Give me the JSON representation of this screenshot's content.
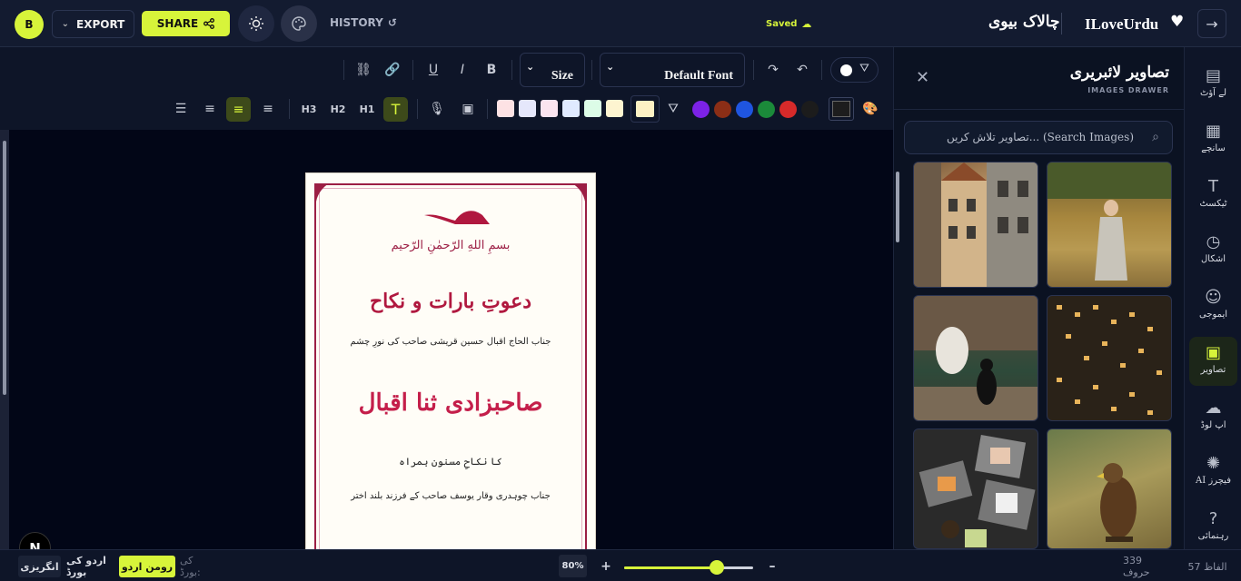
{
  "header": {
    "avatar_initial": "B",
    "export_label": "EXPORT",
    "share_label": "SHARE",
    "history_label": "HISTORY",
    "saved_label": "Saved",
    "brand_urdu": "چالاک بیوی",
    "brand": "ILoveUrdu"
  },
  "toolbar": {
    "size_label": "Size",
    "font_label": "Default Font",
    "headings": [
      "H3",
      "H2",
      "H1"
    ],
    "swatches": [
      "#fde2e4",
      "#e5e7fb",
      "#fbe4f0",
      "#e0eaff",
      "#dcfce7",
      "#fdf4d0"
    ],
    "selected_swatch": "#fdf1c4",
    "dots": [
      "#7c22e6",
      "#8b2e16",
      "#1f55e0",
      "#1b8a3a",
      "#d62a2a",
      "#1c1c1c"
    ]
  },
  "page": {
    "bismillah": "بسمِ اللهِ الرّحمٰنِ الرّحیم",
    "title": "دعوتِ بارات و نکاح",
    "line1": "جناب الحاج اقبال حسین قریشی صاحب کی نورِ چشم",
    "bride": "صاحبزادی ثنا اقبال",
    "line2": "کا نکاحِ مسنون ہمراہ",
    "line3": "جناب چوہدری وقار یوسف صاحب کے فرزند بلند اختر"
  },
  "footer": {
    "keyboard_hint": "کی بورڈ:",
    "roman_urdu": "رومن اردو",
    "urdu_keyboard": "اردو کی بورڈ",
    "english": "انگریزی",
    "zoom": "80%",
    "zoom_level": 0.72,
    "words": "57 الفاظ",
    "chars": "339 حروف"
  },
  "drawer": {
    "title": "تصاویر لائبریری",
    "subtitle": "IMAGES DRAWER",
    "search_placeholder": "تصاویر تلاش کریں... (Search Images)"
  },
  "rail": [
    {
      "label": "لے آؤٹ",
      "icon": "layout-icon"
    },
    {
      "label": "سانچے",
      "icon": "templates-icon"
    },
    {
      "label": "ٹیکسٹ",
      "icon": "text-icon"
    },
    {
      "label": "اشکال",
      "icon": "shapes-icon"
    },
    {
      "label": "ایموجی",
      "icon": "emoji-icon"
    },
    {
      "label": "تصاویر",
      "icon": "image-icon"
    },
    {
      "label": "اپ لوڈ",
      "icon": "upload-icon"
    },
    {
      "label": "AI فیچرز",
      "icon": "ai-icon"
    },
    {
      "label": "رہنمائی",
      "icon": "help-icon"
    }
  ],
  "colors": {
    "accent": "#d7f43a",
    "page_border": "#9c1e44",
    "title_red": "#b0183f"
  }
}
